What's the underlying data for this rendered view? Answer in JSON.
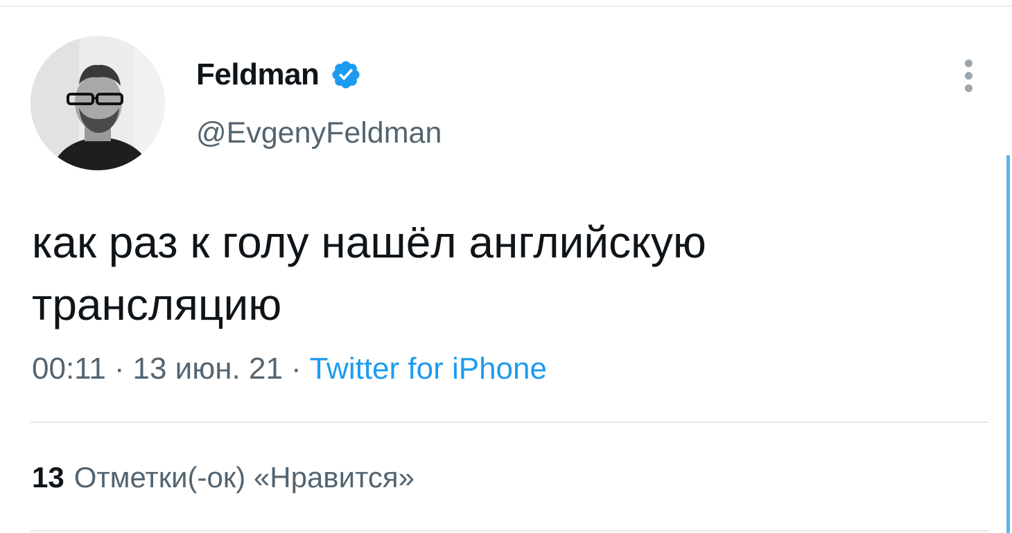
{
  "tweet": {
    "author": {
      "display_name": "Feldman",
      "handle": "@EvgenyFeldman",
      "verified": true
    },
    "text": "как раз к голу нашёл английскую\nтрансляцию",
    "time": "00:11",
    "date": "13 июн. 21",
    "separator": "·",
    "source": "Twitter for iPhone",
    "likes": {
      "count": "13",
      "label": "Отметки(-ок) «Нравится»"
    }
  },
  "colors": {
    "verified_badge": "#1d9bf0",
    "source_link": "#1d9bf0",
    "secondary_text": "#536471",
    "primary_text": "#0f1419",
    "divider": "#e1e8ed",
    "scrollbar": "#5db4ec"
  },
  "icons": {
    "verified": "verified-badge-icon",
    "more": "more-vertical-icon"
  }
}
